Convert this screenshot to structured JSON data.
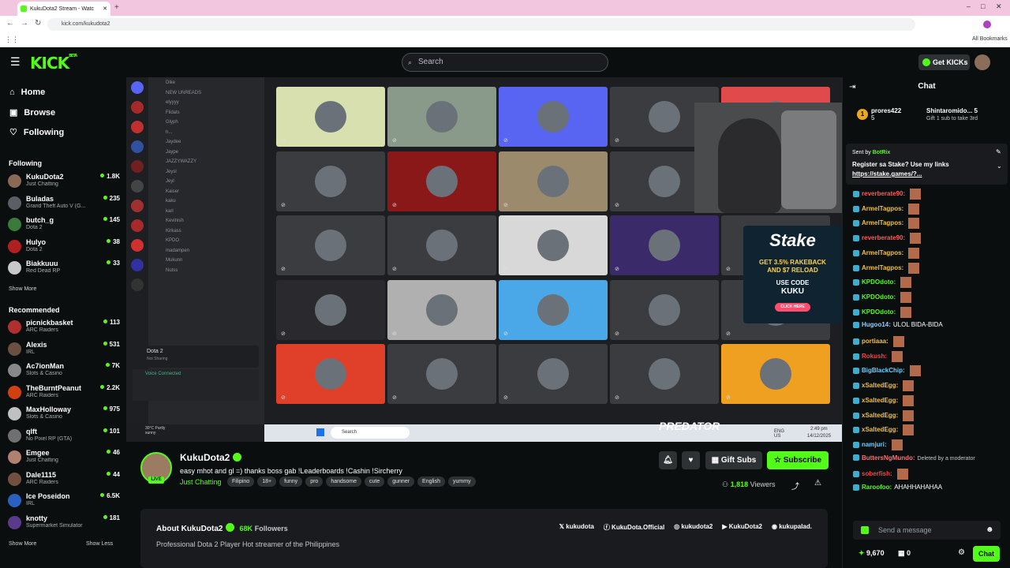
{
  "browser": {
    "tab_title": "KukuDota2 Stream - Watc",
    "url": "kick.com/kukudota2",
    "all_bookmarks": "All Bookmarks"
  },
  "header": {
    "logo": "KICK",
    "logo_beta": "BETA",
    "search_placeholder": "Search",
    "get_kicks": "Get KICKs",
    "brand_color": "#53fc18"
  },
  "sidebar": {
    "nav": [
      {
        "label": "Home",
        "icon": "home-icon"
      },
      {
        "label": "Browse",
        "icon": "browse-icon"
      },
      {
        "label": "Following",
        "icon": "heart-icon"
      }
    ],
    "following_title": "Following",
    "following": [
      {
        "name": "KukuDota2",
        "category": "Just Chatting",
        "viewers": "1.8K",
        "color": "#8a6a55"
      },
      {
        "name": "Buladas",
        "category": "Grand Theft Auto V (G...",
        "viewers": "235",
        "color": "#5a5f66"
      },
      {
        "name": "butch_g",
        "category": "Dota 2",
        "viewers": "145",
        "color": "#3a7a3a"
      },
      {
        "name": "Hulyo",
        "category": "Dota 2",
        "viewers": "38",
        "color": "#b02020"
      },
      {
        "name": "Biakkuuu",
        "category": "Red Dead RP",
        "viewers": "33",
        "color": "#c8c8c8"
      }
    ],
    "show_more_1": "Show More",
    "recommended_title": "Recommended",
    "recommended": [
      {
        "name": "picnickbasket",
        "category": "ARC Raiders",
        "viewers": "113",
        "color": "#b03030"
      },
      {
        "name": "Alexis",
        "category": "IRL",
        "viewers": "531",
        "color": "#6a5040"
      },
      {
        "name": "Ac7ionMan",
        "category": "Slots & Casino",
        "viewers": "7K",
        "color": "#888888"
      },
      {
        "name": "TheBurntPeanut",
        "category": "ARC Raiders",
        "viewers": "2.2K",
        "color": "#d04010"
      },
      {
        "name": "MaxHolloway",
        "category": "Slots & Casino",
        "viewers": "975",
        "color": "#c0c0c0"
      },
      {
        "name": "qlft",
        "category": "No Pixel RP (GTA)",
        "viewers": "101",
        "color": "#707070"
      },
      {
        "name": "Emgee",
        "category": "Just Chatting",
        "viewers": "46",
        "color": "#b08070"
      },
      {
        "name": "Dale1115",
        "category": "ARC Raiders",
        "viewers": "44",
        "color": "#705040"
      },
      {
        "name": "Ice Poseidon",
        "category": "IRL",
        "viewers": "6.5K",
        "color": "#2a60c0"
      },
      {
        "name": "knotty",
        "category": "Supermarket Simulator",
        "viewers": "181",
        "color": "#5a3a8a"
      }
    ],
    "show_more_2": "Show More",
    "show_less": "Show Less"
  },
  "video": {
    "discord_members": [
      "Dike",
      "NEW UNREADS",
      "elyyyy",
      "Flidats",
      "Glyph",
      "h...",
      "Jaydee",
      "Jaype",
      "JAZZYWAZZY",
      "Jeysl",
      "Jeyl",
      "Kaiser",
      "kaku",
      "karl",
      "Kevinish",
      "Kirkass",
      "KPDO",
      "madampen",
      "Mukunn",
      "Nutss"
    ],
    "discord_voice": "Voice Connected",
    "discord_game": "Dota 2",
    "discord_game_sub": "Not Sharing",
    "taskbar_search": "Search",
    "taskbar_time": "2:49 pm",
    "taskbar_date": "14/12/2025",
    "taskbar_lang": "ENG US",
    "weather": "30°C Partly sunny",
    "watermark": "PREDATOR",
    "ad": {
      "brand": "Stake",
      "line1": "GET 3.5% RAKEBACK",
      "line2": "AND $7 RELOAD",
      "code_label": "USE CODE",
      "code": "KUKU",
      "cta": "CLICK HERE"
    }
  },
  "channel": {
    "name": "KukuDota2",
    "live": "LIVE",
    "title": "easy mhot and gl =) thanks boss gab  !Leaderboards !Cashin !Sircherry",
    "category": "Just Chatting",
    "tags": [
      "Filipino",
      "18+",
      "funny",
      "pro",
      "handsome",
      "cute",
      "gunner",
      "English",
      "yummy"
    ],
    "gift_subs": "Gift Subs",
    "subscribe": "Subscribe",
    "viewers": "1,818",
    "viewers_label": "Viewers"
  },
  "about": {
    "title": "About KukuDota2",
    "followers": "68K",
    "followers_label": "Followers",
    "description": "Professional Dota 2 Player Hot streamer of the Philippines",
    "socials": [
      "kukudota",
      "KukuDota.Official",
      "kukudota2",
      "KukuDota2",
      "kukupalad."
    ]
  },
  "chat": {
    "title": "Chat",
    "gifters": [
      {
        "name": "prores422",
        "count": "5",
        "rank": "1"
      },
      {
        "name": "Shintaromido...",
        "count": "5",
        "note": "Gift 1 sub to take 3rd"
      }
    ],
    "pinned": {
      "sent_by": "Sent by",
      "bot": "BotRix",
      "text": "Register sa Stake? Use my links",
      "link": "https://stake.games/?..."
    },
    "messages": [
      {
        "user": "reverberate90:",
        "text": "",
        "color": "#ff5a5a"
      },
      {
        "user": "ArmelTagpos:",
        "text": "",
        "color": "#f0c040"
      },
      {
        "user": "ArmelTagpos:",
        "text": "",
        "color": "#f0c040"
      },
      {
        "user": "reverberate90:",
        "text": "",
        "color": "#ff5a5a"
      },
      {
        "user": "ArmelTagpos:",
        "text": "",
        "color": "#f0c040"
      },
      {
        "user": "ArmelTagpos:",
        "text": "",
        "color": "#f0c040"
      },
      {
        "user": "KPDOdoto:",
        "text": "",
        "color": "#53fc18"
      },
      {
        "user": "KPDOdoto:",
        "text": "",
        "color": "#53fc18"
      },
      {
        "user": "KPDOdoto:",
        "text": "",
        "color": "#53fc18"
      },
      {
        "user": "Hugoo14:",
        "text": "ULOL BIDA-BIDA",
        "color": "#8fd0ff"
      },
      {
        "user": "portiaaa:",
        "text": "",
        "color": "#f0c040"
      },
      {
        "user": "Rokush:",
        "text": "",
        "color": "#ff4040"
      },
      {
        "user": "BigBlackChip:",
        "text": "",
        "color": "#6ad0ff"
      },
      {
        "user": "xSaltedEgg:",
        "text": "",
        "color": "#f0c040"
      },
      {
        "user": "xSaltedEgg:",
        "text": "",
        "color": "#f0c040"
      },
      {
        "user": "xSaltedEgg:",
        "text": "",
        "color": "#f0c040"
      },
      {
        "user": "xSaltedEgg:",
        "text": "",
        "color": "#f0c040"
      },
      {
        "user": "namjuri:",
        "text": "",
        "color": "#6ad0ff"
      },
      {
        "user": "ButtersNgMundo:",
        "text": "Deleted by a moderator",
        "color": "#ff7070"
      },
      {
        "user": "soberfish:",
        "text": "",
        "color": "#ff4040"
      },
      {
        "user": "Raroofoo:",
        "text": "AHAHHAHAHAA",
        "color": "#53fc18"
      }
    ],
    "input_placeholder": "Send a message",
    "points": "9,670",
    "gift_count": "0",
    "send": "Chat"
  }
}
